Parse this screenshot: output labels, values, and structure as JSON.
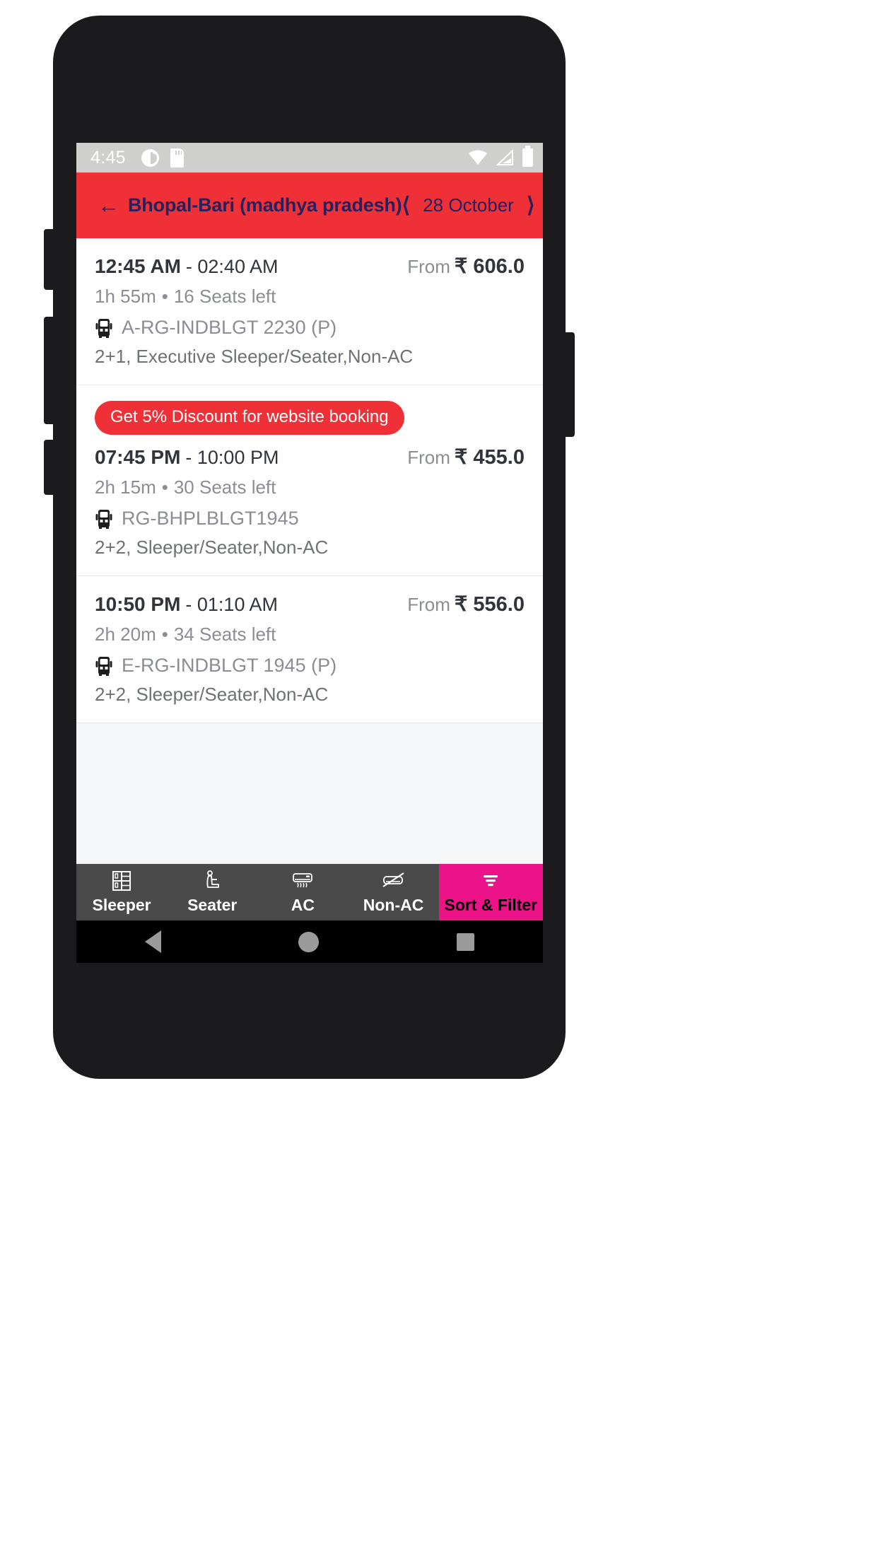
{
  "status_bar": {
    "time": "4:45",
    "icons_left": [
      "do-not-disturb-icon",
      "sd-card-icon"
    ],
    "icons_right": [
      "wifi-icon",
      "cell-signal-icon",
      "battery-icon"
    ]
  },
  "header": {
    "back_icon": "back-arrow-icon",
    "route_title": "Bhopal-Bari (madhya pradesh)",
    "prev_icon": "chevron-left-icon",
    "date": "28 October",
    "next_icon": "chevron-right-icon",
    "bg_color": "#ef3137",
    "text_color": "#24215e"
  },
  "results": [
    {
      "promo": null,
      "departure": "12:45 AM",
      "arrival": "- 02:40 AM",
      "price_from_label": "From",
      "price": "₹ 606.0",
      "duration": "1h 55m",
      "separator": "•",
      "seats_left": "16 Seats left",
      "bus_icon": "bus-icon",
      "bus_code": "A-RG-INDBLGT 2230 (P)",
      "bus_type": "2+1, Executive Sleeper/Seater,Non-AC"
    },
    {
      "promo": "Get 5% Discount for website booking",
      "departure": "07:45 PM",
      "arrival": "- 10:00 PM",
      "price_from_label": "From",
      "price": "₹ 455.0",
      "duration": "2h 15m",
      "separator": "•",
      "seats_left": "30 Seats left",
      "bus_icon": "bus-icon",
      "bus_code": "RG-BHPLBLGT1945",
      "bus_type": "2+2, Sleeper/Seater,Non-AC"
    },
    {
      "promo": null,
      "departure": "10:50 PM",
      "arrival": "- 01:10 AM",
      "price_from_label": "From",
      "price": "₹ 556.0",
      "duration": "2h 20m",
      "separator": "•",
      "seats_left": "34 Seats left",
      "bus_icon": "bus-icon",
      "bus_code": "E-RG-INDBLGT 1945 (P)",
      "bus_type": "2+2, Sleeper/Seater,Non-AC"
    }
  ],
  "filter_bar": {
    "bg_color": "#4a4a4a",
    "accent_color": "#ec1389",
    "items": [
      {
        "label": "Sleeper",
        "icon": "sleeper-berth-icon",
        "active": false
      },
      {
        "label": "Seater",
        "icon": "seat-icon",
        "active": false
      },
      {
        "label": "AC",
        "icon": "air-conditioner-icon",
        "active": false
      },
      {
        "label": "Non-AC",
        "icon": "no-ac-icon",
        "active": false
      },
      {
        "label": "Sort & Filter",
        "icon": "filter-icon",
        "active": true
      }
    ]
  },
  "nav_bar": {
    "back": "back-triangle-icon",
    "home": "home-circle-icon",
    "recents": "recents-square-icon"
  }
}
